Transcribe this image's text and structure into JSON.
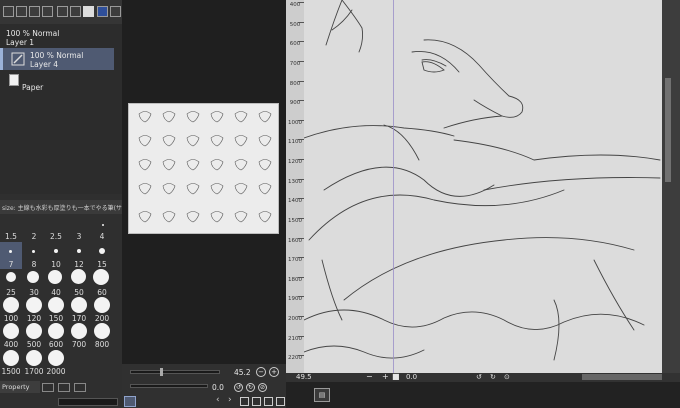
{
  "layers": [
    {
      "opacity_blend": "100 % Normal",
      "name": "Layer 1"
    },
    {
      "opacity_blend": "100 % Normal",
      "name": "Layer 4"
    },
    {
      "name": "Paper"
    }
  ],
  "brush_panel": {
    "header": "size: 主線も水彩も厚塗りも一本でやる筆(サ)",
    "sizes": [
      "1.5",
      "2",
      "2.5",
      "3",
      "4",
      "7",
      "8",
      "10",
      "12",
      "15",
      "25",
      "30",
      "40",
      "50",
      "60",
      "100",
      "120",
      "150",
      "170",
      "200",
      "400",
      "500",
      "600",
      "700",
      "800",
      "1500",
      "1700",
      "2000"
    ]
  },
  "property_tab": "Property",
  "navigator": {
    "zoom": "45.2",
    "angle": "0.0"
  },
  "status": {
    "zoom": "49.5",
    "angle": "0.0"
  },
  "ruler_ticks": [
    "400",
    "500",
    "600",
    "700",
    "800",
    "900",
    "1000",
    "1100",
    "1200",
    "1300",
    "1400",
    "1500",
    "1600",
    "1700",
    "1800",
    "1900",
    "2000",
    "2100",
    "2200"
  ],
  "colors": {
    "selected_layer": "#4f5a72",
    "canvas": "#dcdcdc",
    "guide_line": "#9a8ec8"
  }
}
